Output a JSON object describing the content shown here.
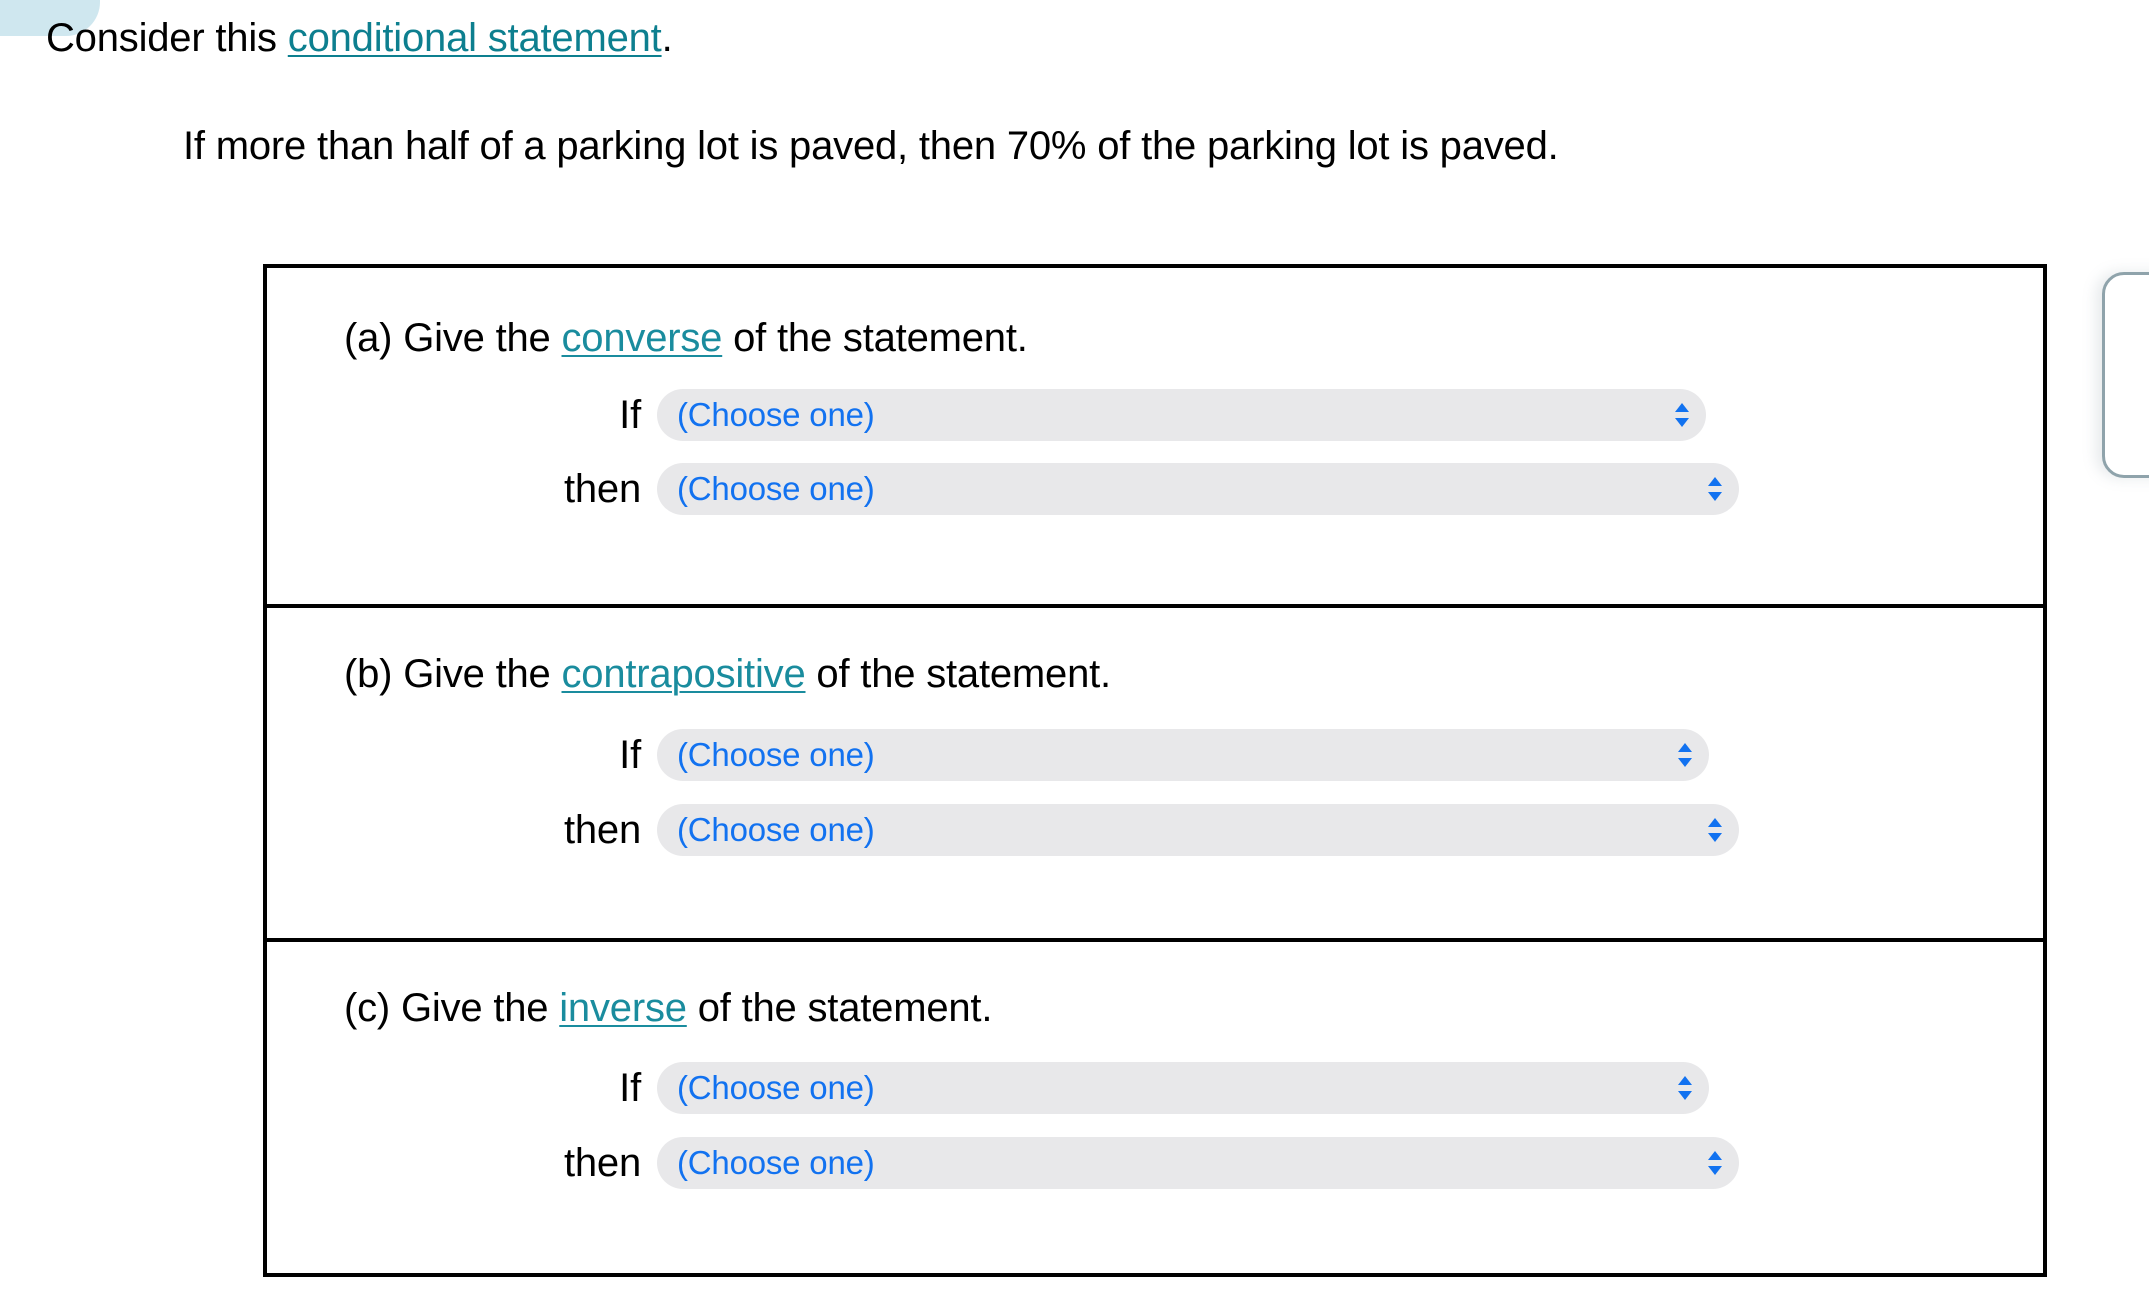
{
  "colors": {
    "link_teal": "#1a8c9e",
    "select_text_blue": "#1272f0",
    "select_fill_gray": "#e8e8ea",
    "corner_tab_blue": "#cfe7ef",
    "box_border": "#000000"
  },
  "intro": {
    "lead_text": "Consider this ",
    "link_text": "conditional statement",
    "trailing_text": "."
  },
  "statement": {
    "text": "If more than half of a parking lot is paved, then 70% of the parking lot is paved."
  },
  "parts": [
    {
      "id": "a",
      "marker": "(a)",
      "heading_before": "Give the ",
      "heading_link": "converse",
      "heading_after": " of the statement.",
      "rows": [
        {
          "label": "If",
          "value": "(Choose one)",
          "icon": "chevron-up-down-icon"
        },
        {
          "label": "then",
          "value": "(Choose one)",
          "icon": "chevron-up-down-icon"
        }
      ]
    },
    {
      "id": "b",
      "marker": "(b)",
      "heading_before": "Give the ",
      "heading_link": "contrapositive",
      "heading_after": " of the statement.",
      "rows": [
        {
          "label": "If",
          "value": "(Choose one)",
          "icon": "chevron-up-down-icon"
        },
        {
          "label": "then",
          "value": "(Choose one)",
          "icon": "chevron-up-down-icon"
        }
      ]
    },
    {
      "id": "c",
      "marker": "(c)",
      "heading_before": "Give the ",
      "heading_link": "inverse",
      "heading_after": " of the statement.",
      "rows": [
        {
          "label": "If",
          "value": "(Choose one)",
          "icon": "chevron-up-down-icon"
        },
        {
          "label": "then",
          "value": "(Choose one)",
          "icon": "chevron-up-down-icon"
        }
      ]
    }
  ]
}
